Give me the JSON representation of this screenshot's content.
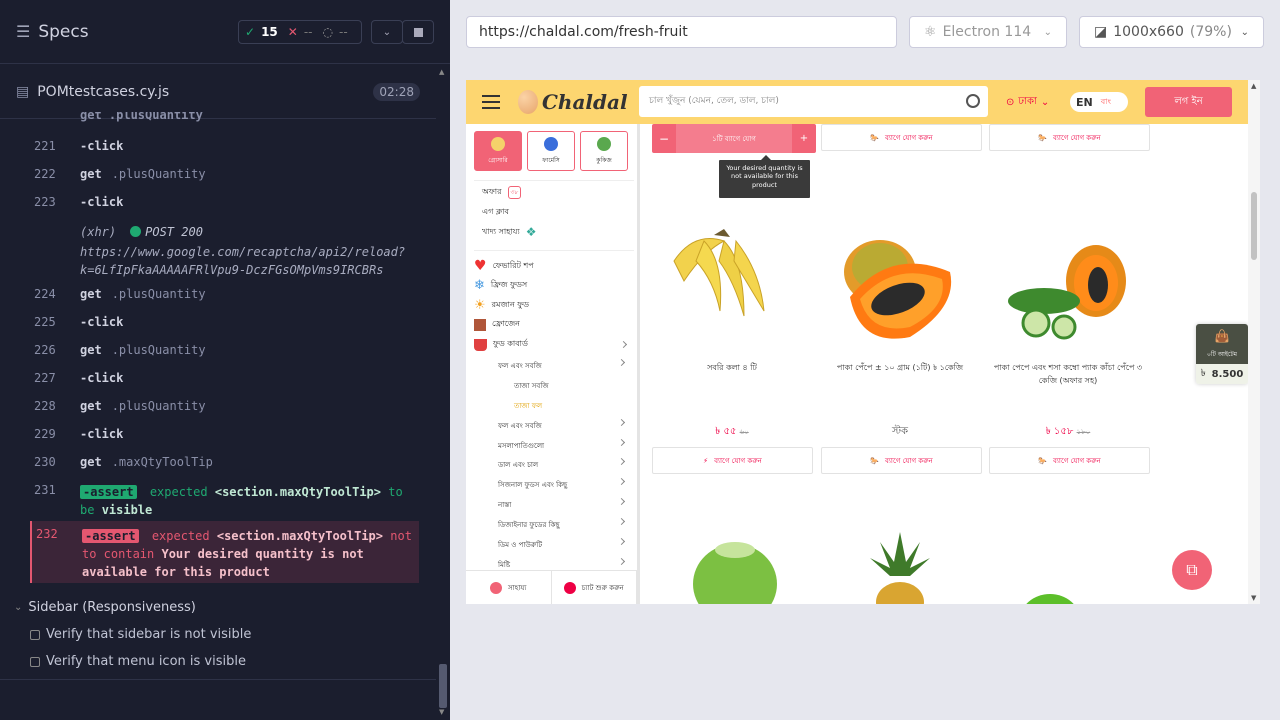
{
  "runner": {
    "title": "Specs",
    "passed": "15",
    "failed": "--",
    "pending": "--",
    "file": "POMtestcases.cy.js",
    "timer": "02:28",
    "log": [
      {
        "n": "221",
        "cmd": "-click",
        "arg": ""
      },
      {
        "n": "222",
        "cmd": "get",
        "arg": ".plusQuantity"
      },
      {
        "n": "223",
        "cmd": "-click",
        "arg": ""
      },
      {
        "n": "",
        "cmd": "(xhr)",
        "arg": "POST 200"
      },
      {
        "n": "224",
        "cmd": "get",
        "arg": ".plusQuantity"
      },
      {
        "n": "225",
        "cmd": "-click",
        "arg": ""
      },
      {
        "n": "226",
        "cmd": "get",
        "arg": ".plusQuantity"
      },
      {
        "n": "227",
        "cmd": "-click",
        "arg": ""
      },
      {
        "n": "228",
        "cmd": "get",
        "arg": ".plusQuantity"
      },
      {
        "n": "229",
        "cmd": "-click",
        "arg": ""
      },
      {
        "n": "230",
        "cmd": "get",
        "arg": ".maxQtyToolTip"
      },
      {
        "n": "231",
        "cmd": "-assert",
        "arg": "expected"
      },
      {
        "n": "232",
        "cmd": "-assert",
        "arg": "expected"
      }
    ],
    "top_cut_line": "get .plusQuantity",
    "xhr_url": "https://www.google.com/recaptcha/api2/reload?k=6LfIpFkaAAAAAFRlVpu9-DczFGsOMpVms9IRCBRs",
    "assert231_selector": "<section.maxQtyToolTip>",
    "assert231_tail_a": "to",
    "assert231_tail_b": "be",
    "assert231_tail_c": "visible",
    "assert232_selector": "<section.maxQtyToolTip>",
    "assert232_tail_a": "not to contain",
    "assert232_tail_b": "Your desired quantity is not available for this product",
    "sidebar_section": "Sidebar (Responsiveness)",
    "sidebar_tests": [
      "Verify that sidebar is not visible",
      "Verify that menu icon is visible"
    ]
  },
  "browser": {
    "url": "https://chaldal.com/fresh-fruit",
    "engine": "Electron 114",
    "viewport": "1000x660",
    "zoom": "(79%)"
  },
  "app": {
    "brand": "Chaldal",
    "search_placeholder": "চাল খুঁজুন (যেমন, তেল, ডাল, চাল)",
    "location": "ঢাকা",
    "lang_en": "EN",
    "lang_bn": "বাং",
    "login": "লগ ইন",
    "tabs": [
      "গ্রোসারি",
      "ফার্মেসি",
      "কুকিজ"
    ],
    "offers": "অফার",
    "offers_badge": "৩৮",
    "egg_club": "এগ ক্লাব",
    "food_aid": "খাদ্য সাহায্য",
    "cats": [
      "ফেভারিট শপ",
      "ফ্রিজ ফুডস",
      "রমজান ফুড",
      "ফ্রোজেন",
      "ফুড কাবার্ড"
    ],
    "subcats": [
      "ফল এবং সবজি",
      "তাজা ফল",
      "তাজা সবজি",
      "ফল এবং সবজি",
      "মসলাপাতিগুলো",
      "ডাল এবং চাল",
      "সিজনাল ফুডস এবং কিছু",
      "নাস্তা",
      "ডিজাইনার ফুডের কিছু",
      "ডিম ও পাউরুটি",
      "মিষ্টি"
    ],
    "help": "সাহায্য",
    "chat": "চ্যাট শুরু করুন",
    "cart_label": "০টি আইটেম",
    "cart_total": "8.500",
    "add_label": "ব্যাগে যোগ করুন",
    "qty_label": "১টি ব্যাগে যোগ",
    "tooltip": "Your desired quantity is not available for this product",
    "products": [
      {
        "name": "সবরি কলা ৪ টি",
        "price": "৳ ৫৫",
        "old": "৬০"
      },
      {
        "name": "পাকা পেঁপে ± ১০ গ্রাম (১টি) ৳ ১কেজি",
        "price": "স্টক",
        "old": ""
      },
      {
        "name": "পাকা পেপে এবং শসা কম্বো প্যাক কাঁচা পেঁপে ৩ কেজি (অফার সহ)",
        "price": "৳ ১৫৮",
        "old": "১৮০"
      }
    ]
  },
  "colors": {
    "brand_yellow": "#fdd670",
    "brand_pink": "#f16376",
    "runner_bg": "#1b1e2e",
    "pass_green": "#1fa971",
    "fail_red": "#e45770"
  }
}
